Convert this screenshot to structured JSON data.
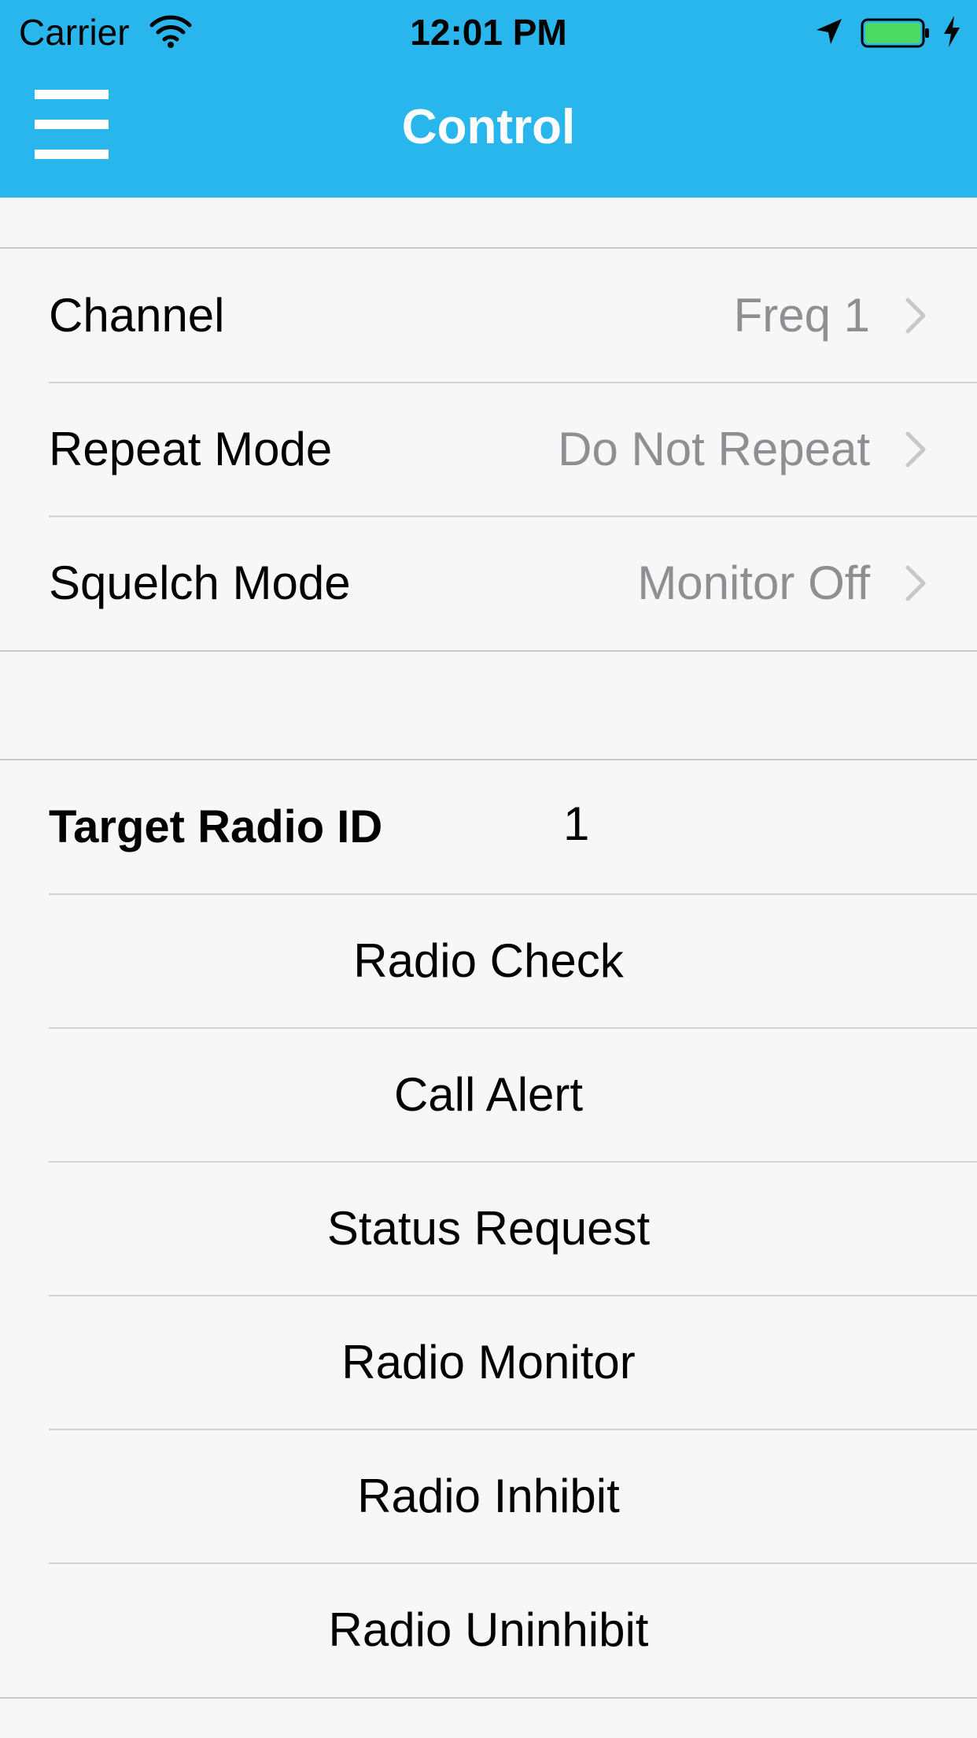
{
  "status_bar": {
    "carrier": "Carrier",
    "time": "12:01 PM",
    "wifi_icon": "wifi-icon",
    "location_icon": "location-arrow-icon",
    "battery_icon": "battery-icon",
    "charging_icon": "charging-bolt-icon",
    "battery_color": "#4cd964"
  },
  "nav": {
    "title": "Control",
    "menu_icon": "hamburger-menu-icon",
    "bar_color": "#29b6ec"
  },
  "settings": {
    "channel": {
      "label": "Channel",
      "value": "Freq 1"
    },
    "repeat_mode": {
      "label": "Repeat Mode",
      "value": "Do Not Repeat"
    },
    "squelch_mode": {
      "label": "Squelch Mode",
      "value": "Monitor Off"
    }
  },
  "target": {
    "label": "Target Radio ID",
    "value": "1"
  },
  "actions": {
    "radio_check": "Radio Check",
    "call_alert": "Call Alert",
    "status_request": "Status Request",
    "radio_monitor": "Radio Monitor",
    "radio_inhibit": "Radio Inhibit",
    "radio_uninhibit": "Radio Uninhibit"
  }
}
